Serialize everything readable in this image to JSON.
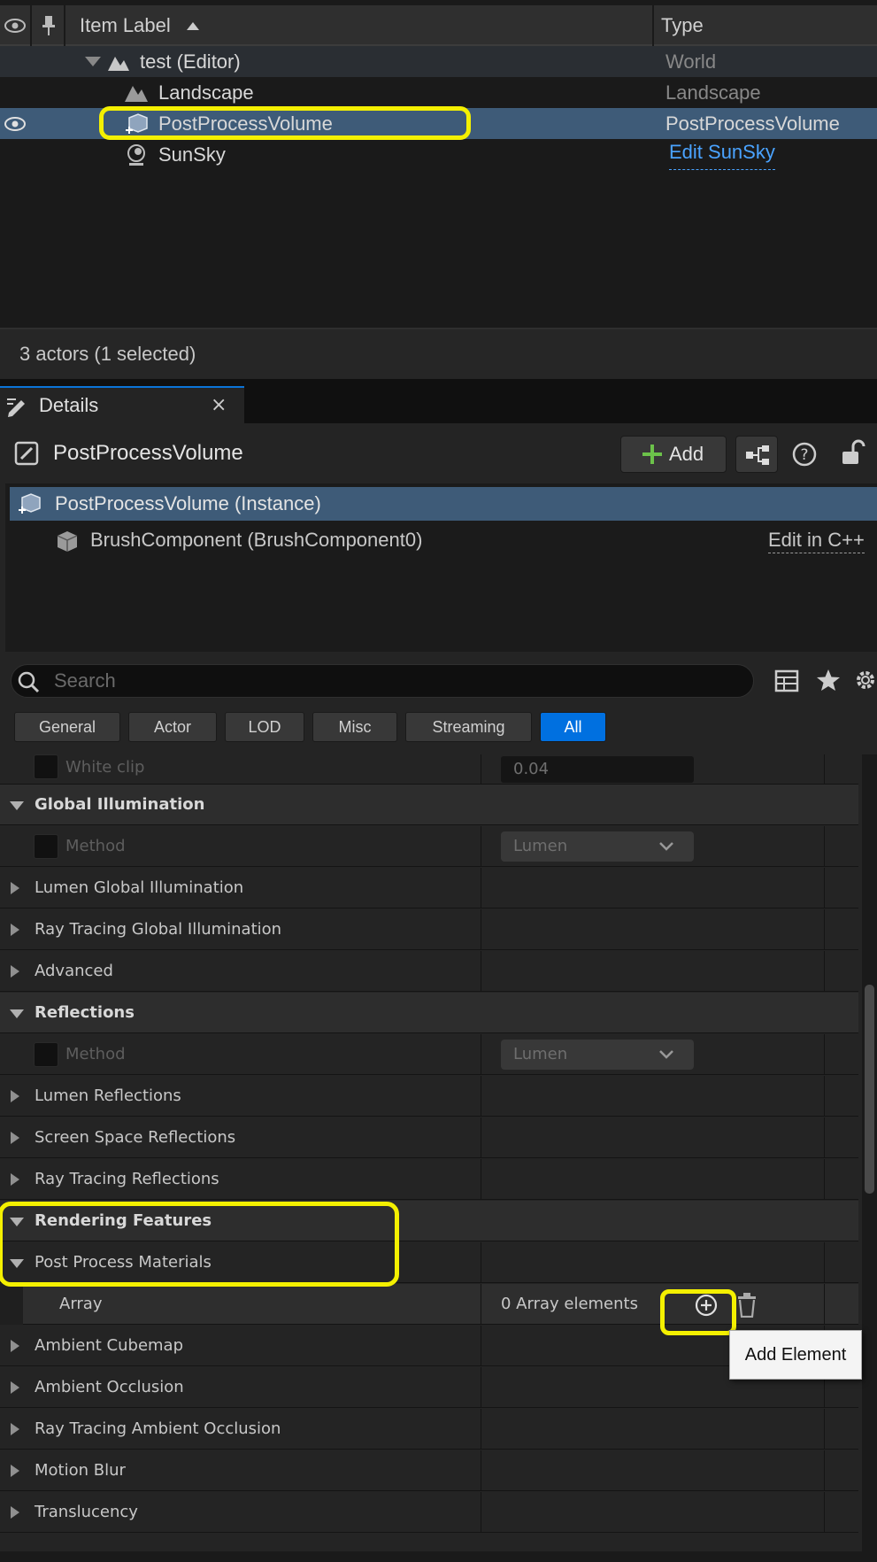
{
  "outliner": {
    "columns": {
      "label": "Item Label",
      "type": "Type"
    },
    "rows": [
      {
        "label": "test (Editor)",
        "type": "World"
      },
      {
        "label": "Landscape",
        "type": "Landscape"
      },
      {
        "label": "PostProcessVolume",
        "type": "PostProcessVolume"
      },
      {
        "label": "SunSky",
        "type": "Edit SunSky"
      }
    ],
    "status": "3 actors (1 selected)"
  },
  "details": {
    "tab_title": "Details",
    "close_glyph": "×",
    "actor_name": "PostProcessVolume",
    "add_label": "Add",
    "components": {
      "instance": "PostProcessVolume (Instance)",
      "brush": "BrushComponent (BrushComponent0)",
      "edit_cpp": "Edit in C++"
    },
    "search_placeholder": "Search",
    "filters": [
      "General",
      "Actor",
      "LOD",
      "Misc",
      "Streaming",
      "All"
    ],
    "properties": {
      "white_clip": {
        "label": "White clip",
        "value": "0.04"
      },
      "global_illumination": "Global Illumination",
      "gi_method": {
        "label": "Method",
        "value": "Lumen"
      },
      "lumen_gi": "Lumen Global Illumination",
      "rt_gi": "Ray Tracing Global Illumination",
      "advanced": "Advanced",
      "reflections": "Reflections",
      "refl_method": {
        "label": "Method",
        "value": "Lumen"
      },
      "lumen_refl": "Lumen Reflections",
      "ssr": "Screen Space Reflections",
      "rt_refl": "Ray Tracing Reflections",
      "rendering_features": "Rendering Features",
      "post_process_materials": "Post Process Materials",
      "array": {
        "label": "Array",
        "value": "0 Array elements"
      },
      "ambient_cubemap": "Ambient Cubemap",
      "ambient_occlusion": "Ambient Occlusion",
      "rt_ao": "Ray Tracing Ambient Occlusion",
      "motion_blur": "Motion Blur",
      "translucency": "Translucency"
    },
    "tooltip": "Add Element"
  },
  "colors": {
    "highlight": "#f4f000",
    "selection": "#3e5b78",
    "accent": "#0070e0",
    "link": "#4aa3ff"
  }
}
